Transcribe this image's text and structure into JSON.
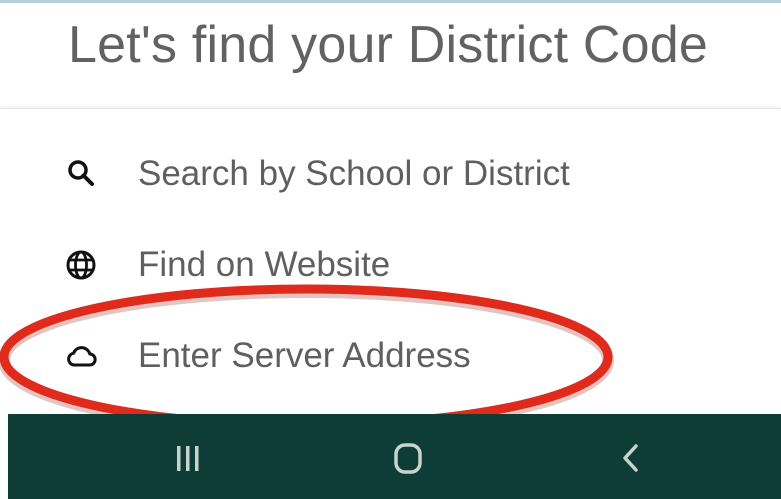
{
  "header": {
    "title": "Let's find your District Code"
  },
  "options": [
    {
      "label": "Search by School or District",
      "icon": "search-icon"
    },
    {
      "label": "Find on Website",
      "icon": "globe-icon"
    },
    {
      "label": "Enter Server Address",
      "icon": "cloud-icon"
    }
  ],
  "annotation": {
    "highlight_color": "#e02a1b",
    "highlighted_option": "Enter Server Address"
  },
  "navbar": {
    "background": "#0e3d37",
    "buttons": [
      "recent-apps-icon",
      "home-icon",
      "back-icon"
    ]
  }
}
